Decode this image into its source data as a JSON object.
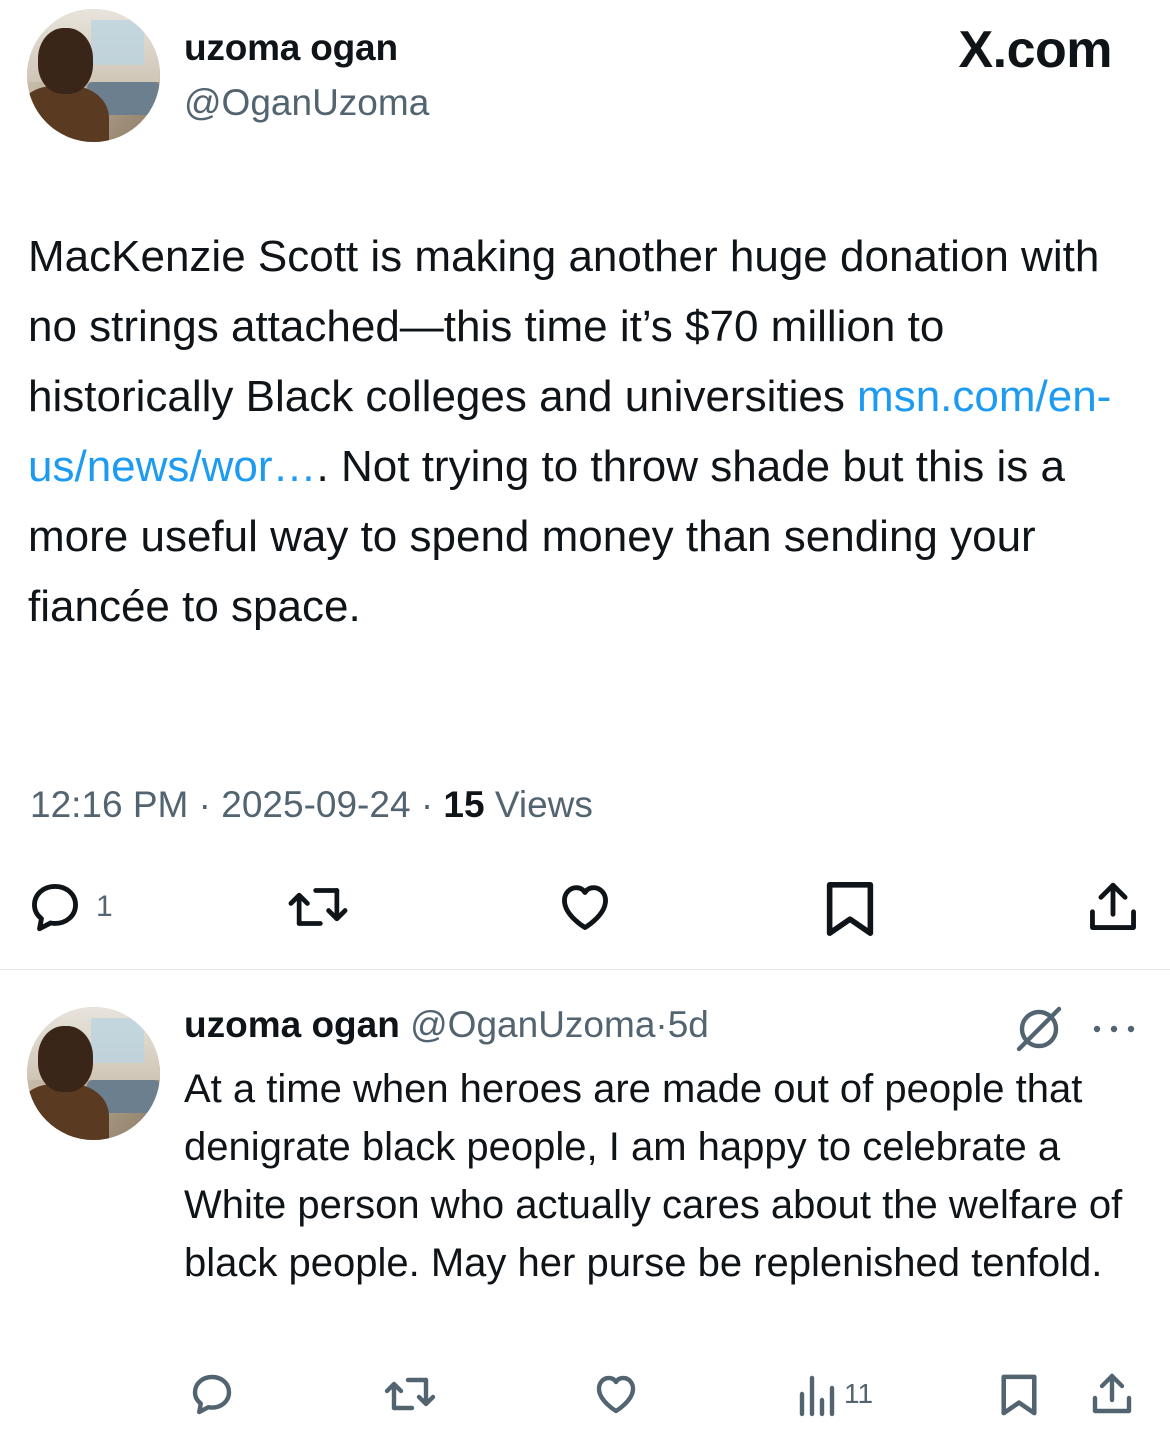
{
  "brand": {
    "label": "X.com"
  },
  "tweet": {
    "author_name": "uzoma ogan",
    "author_handle": "@OganUzoma",
    "text_before_link": "MacKenzie Scott is making another huge donation with no strings attached—this time it’s $70 million to historically Black colleges and universities ",
    "link_text": "msn.com/en-us/news/wor…",
    "text_after_link": ". Not trying to throw shade but this is a more useful way to spend money than sending your fiancée to space.",
    "time": "12:16 PM",
    "separator": "·",
    "date": "2025-09-24",
    "views_count": "15",
    "views_label": "Views",
    "actions": {
      "reply_count": "1",
      "reply_icon": "reply-icon",
      "retweet_icon": "retweet-icon",
      "like_icon": "heart-icon",
      "bookmark_icon": "bookmark-icon",
      "share_icon": "share-icon"
    }
  },
  "reply": {
    "author_name": "uzoma ogan",
    "author_handle": "@OganUzoma",
    "separator": "·",
    "age": "5d",
    "text": "At a time when heroes are made out of people that denigrate black people, I am happy to celebrate a White person who actually cares about the welfare of black people. May her purse be replenished tenfold.",
    "actions": {
      "views_count": "11",
      "reply_icon": "reply-icon",
      "retweet_icon": "retweet-icon",
      "like_icon": "heart-icon",
      "views_icon": "analytics-icon",
      "bookmark_icon": "bookmark-icon",
      "share_icon": "share-icon"
    }
  },
  "colors": {
    "text": "#0f1419",
    "secondary": "#536471",
    "link": "#1d9bf0",
    "divider": "#e1e6ea"
  }
}
